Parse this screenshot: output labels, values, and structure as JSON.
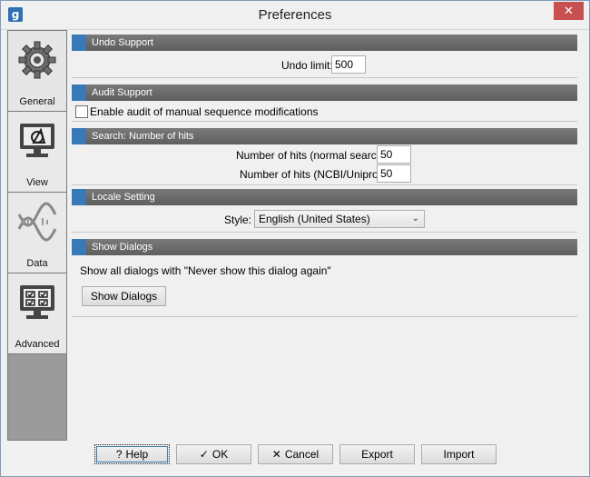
{
  "window": {
    "title": "Preferences",
    "app_icon_text": "g",
    "close_symbol": "✕"
  },
  "sidebar": {
    "items": [
      {
        "label": "General",
        "icon": "gear-icon"
      },
      {
        "label": "View",
        "icon": "monitor-icon"
      },
      {
        "label": "Data",
        "icon": "dna-icon"
      },
      {
        "label": "Advanced",
        "icon": "advanced-settings-icon"
      }
    ]
  },
  "sections": {
    "undo": {
      "title": "Undo Support",
      "limit_label": "Undo limit:",
      "limit_value": "500"
    },
    "audit": {
      "title": "Audit Support",
      "checkbox_label": "Enable audit of manual sequence modifications",
      "checked": false
    },
    "search": {
      "title": "Search: Number of hits",
      "normal_label": "Number of hits (normal search):",
      "normal_value": "50",
      "ncbi_label": "Number of hits (NCBI/Uniprot):",
      "ncbi_value": "50"
    },
    "locale": {
      "title": "Locale Setting",
      "style_label": "Style:",
      "style_value": "English (United States)"
    },
    "dialogs": {
      "title": "Show Dialogs",
      "description": "Show all dialogs with \"Never show this dialog again\"",
      "button_label": "Show Dialogs"
    }
  },
  "footer": {
    "help_label": "Help",
    "help_icon": "?",
    "ok_label": "OK",
    "ok_icon": "✓",
    "cancel_label": "Cancel",
    "cancel_icon": "✕",
    "export_label": "Export",
    "import_label": "Import"
  },
  "colors": {
    "section_header": "#6b6b6b",
    "section_marker": "#3a79b8",
    "close_button": "#c75050"
  }
}
